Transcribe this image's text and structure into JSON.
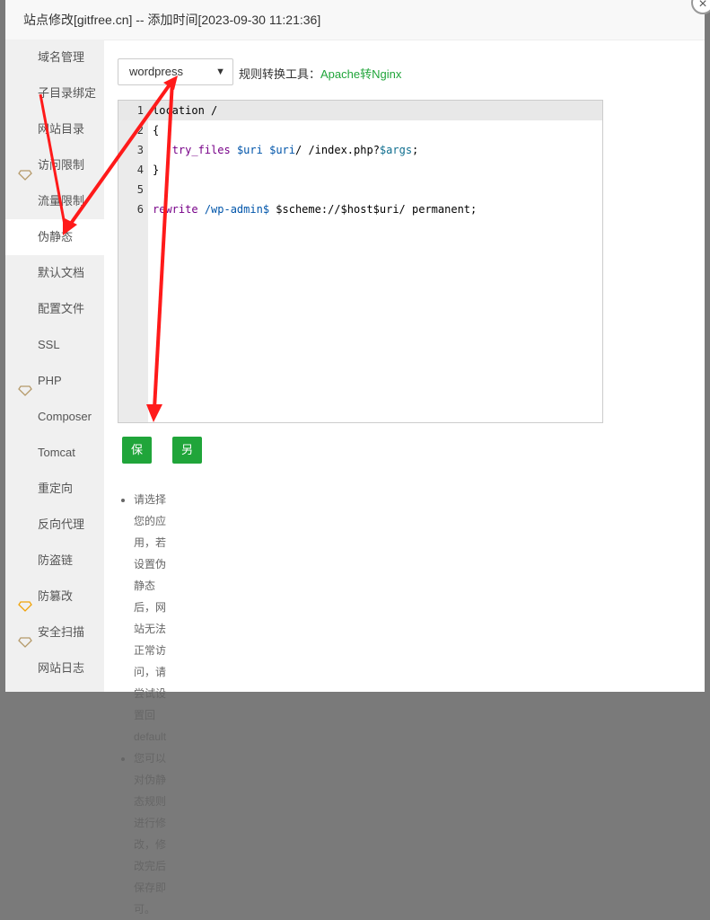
{
  "title": "站点修改[gitfree.cn] -- 添加时间[2023-09-30 11:21:36]",
  "close_icon": "×",
  "sidebar": {
    "items": [
      {
        "label": "域名管理"
      },
      {
        "label": "子目录绑定"
      },
      {
        "label": "网站目录"
      },
      {
        "label": "访问限制",
        "icon": "enterprise-gem-icon"
      },
      {
        "label": "流量限制"
      },
      {
        "label": "伪静态",
        "active": true
      },
      {
        "label": "默认文档"
      },
      {
        "label": "配置文件"
      },
      {
        "label": "SSL"
      },
      {
        "label": "PHP",
        "icon": "enterprise-gem-icon"
      },
      {
        "label": "Composer"
      },
      {
        "label": "Tomcat"
      },
      {
        "label": "重定向"
      },
      {
        "label": "反向代理"
      },
      {
        "label": "防盗链"
      },
      {
        "label": "防篡改",
        "icon": "pro-gem-icon"
      },
      {
        "label": "安全扫描",
        "icon": "enterprise-gem-icon"
      },
      {
        "label": "网站日志"
      }
    ]
  },
  "main": {
    "template_select": "wordpress",
    "tool_label": "规则转换工具：",
    "tool_link": "Apache转Nginx",
    "code_lines": [
      "1",
      "2",
      "3",
      "4",
      "5",
      "6"
    ],
    "save": "保存",
    "save_template": "另存为模板",
    "tips": [
      "请选择您的应用，若设置伪静态后，网站无法正常访问，请尝试设置回default",
      "您可以对伪静态规则进行修改，修改完后保存即可。"
    ]
  },
  "colors": {
    "accent": "#20a53a",
    "arrow": "#ff1a1a"
  }
}
